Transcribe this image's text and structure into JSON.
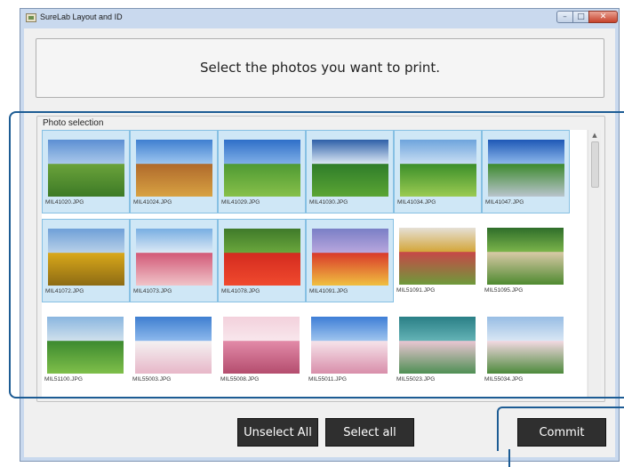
{
  "window": {
    "title": "SureLab Layout and ID"
  },
  "banner": {
    "text": "Select the photos you want to print."
  },
  "group": {
    "label": "Photo selection"
  },
  "photos": [
    {
      "name": "MIL41020.JPG",
      "selected": true,
      "colors": [
        "#5c8fd3",
        "#a9c8ea",
        "#6aa23a",
        "#3d7a26"
      ]
    },
    {
      "name": "MIL41024.JPG",
      "selected": true,
      "colors": [
        "#3f7fd0",
        "#9cc5ef",
        "#b06a2c",
        "#d8a242"
      ]
    },
    {
      "name": "MIL41029.JPG",
      "selected": true,
      "colors": [
        "#2f6fc8",
        "#7eaee6",
        "#4f9a33",
        "#87c04a"
      ]
    },
    {
      "name": "MIL41030.JPG",
      "selected": true,
      "colors": [
        "#2e5fa8",
        "#d9e6f4",
        "#2f7d2a",
        "#5ba534"
      ]
    },
    {
      "name": "MIL41034.JPG",
      "selected": true,
      "colors": [
        "#6ea4dc",
        "#c7ddf3",
        "#3c8f2a",
        "#9bcb52"
      ]
    },
    {
      "name": "MIL41047.JPG",
      "selected": true,
      "colors": [
        "#1e58b6",
        "#8bb6ea",
        "#3d8a2e",
        "#b9c4cc"
      ]
    },
    {
      "name": "MIL41072.JPG",
      "selected": true,
      "colors": [
        "#6fa0d8",
        "#b8d0e8",
        "#d9a81a",
        "#8d6b14"
      ]
    },
    {
      "name": "MIL41073.JPG",
      "selected": true,
      "colors": [
        "#78aee2",
        "#dbe9f5",
        "#d25a78",
        "#f0c3c8"
      ]
    },
    {
      "name": "MIL41078.JPG",
      "selected": true,
      "colors": [
        "#3f7a2a",
        "#6aa63c",
        "#d42b1f",
        "#f04a2e"
      ]
    },
    {
      "name": "MIL41091.JPG",
      "selected": true,
      "colors": [
        "#7a7fc6",
        "#b8a6dd",
        "#d93a2a",
        "#f0c040"
      ]
    },
    {
      "name": "MIL51091.JPG",
      "selected": false,
      "colors": [
        "#e5e0d6",
        "#d4a63a",
        "#c64848",
        "#6e9a3b"
      ]
    },
    {
      "name": "MIL51095.JPG",
      "selected": false,
      "colors": [
        "#2f6e2a",
        "#7ab34a",
        "#d8c9a6",
        "#4f8a30"
      ]
    },
    {
      "name": "MIL51100.JPG",
      "selected": false,
      "colors": [
        "#8ab6e0",
        "#cfe0ec",
        "#3d8a2f",
        "#7fbf4a"
      ]
    },
    {
      "name": "MIL55003.JPG",
      "selected": false,
      "colors": [
        "#3f7fd0",
        "#8cb8ec",
        "#f4f1f2",
        "#e7b7c8"
      ]
    },
    {
      "name": "MIL55008.JPG",
      "selected": false,
      "colors": [
        "#f3d1dc",
        "#f8e6ec",
        "#e28aa8",
        "#b44d6e"
      ]
    },
    {
      "name": "MIL55011.JPG",
      "selected": false,
      "colors": [
        "#3e7ed6",
        "#9ec4ee",
        "#f6e3ea",
        "#d88eaa"
      ]
    },
    {
      "name": "MIL55023.JPG",
      "selected": false,
      "colors": [
        "#2a7f86",
        "#63b2b5",
        "#e9c6d2",
        "#4f8f54"
      ]
    },
    {
      "name": "MIL55034.JPG",
      "selected": false,
      "colors": [
        "#98bde4",
        "#d8e6f4",
        "#f2d8e1",
        "#4d8a3c"
      ]
    }
  ],
  "buttons": {
    "unselect_all": "Unselect All",
    "select_all": "Select all",
    "commit": "Commit"
  },
  "colors": {
    "selection_bg": "#cfe7f6",
    "selection_border": "#86c0e3",
    "button_bg": "#2f2f2f",
    "callout": "#1d5c94"
  }
}
